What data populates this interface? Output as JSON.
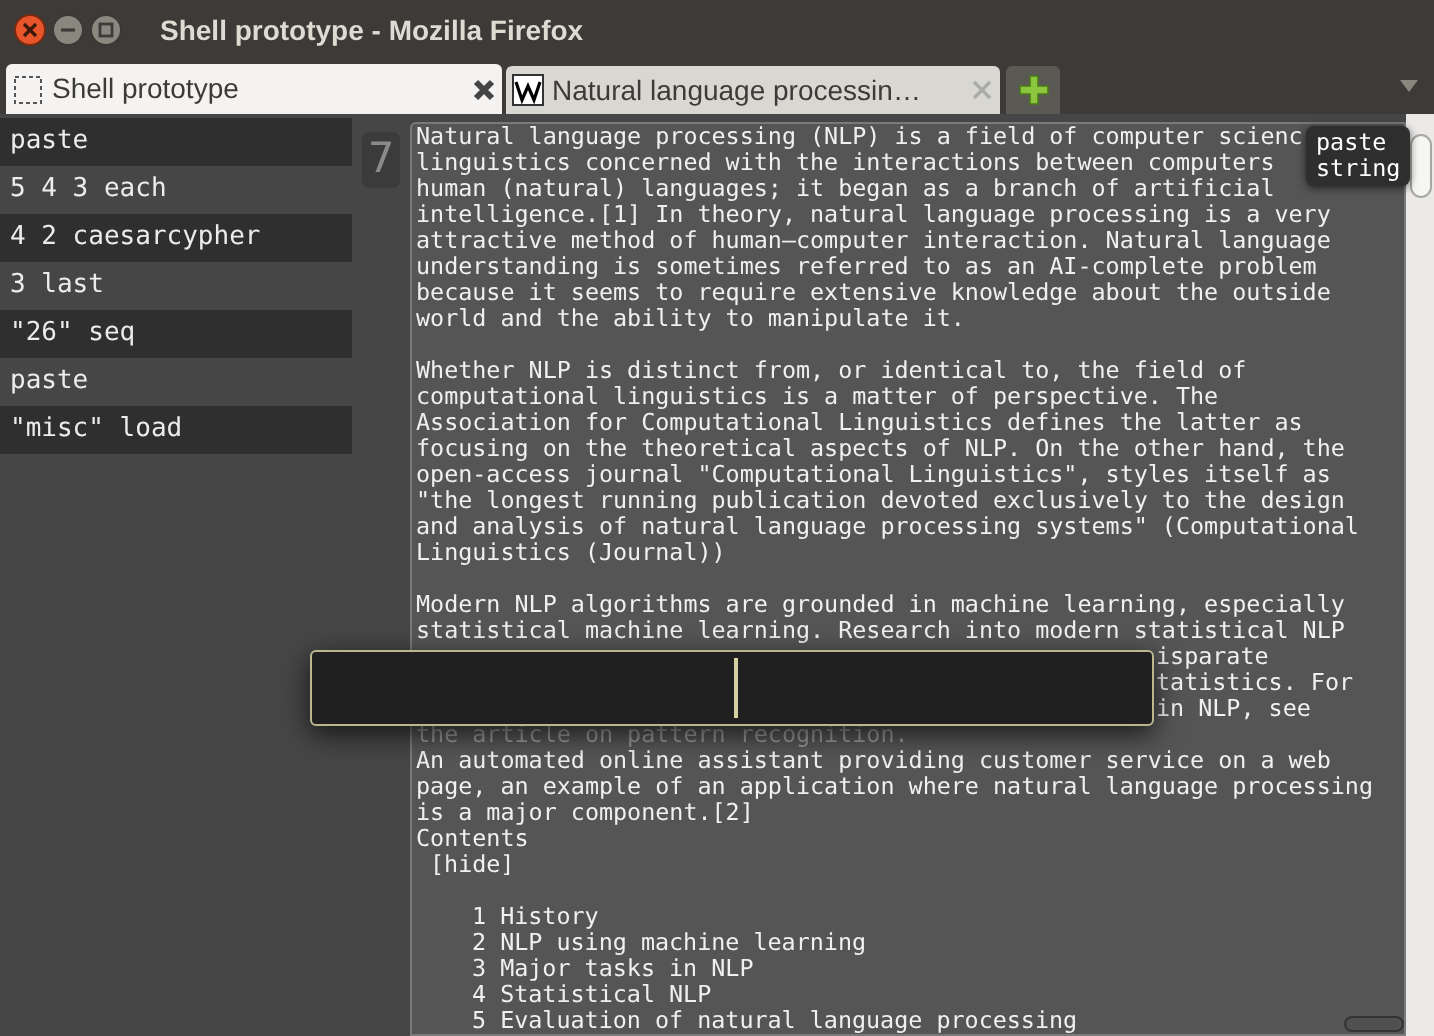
{
  "window": {
    "title": "Shell prototype - Mozilla Firefox"
  },
  "tabs": [
    {
      "label": "Shell prototype",
      "selected": true,
      "kind": "blank"
    },
    {
      "label": "Natural language processin…",
      "selected": false,
      "kind": "wiki"
    }
  ],
  "commands": [
    "paste",
    "5 4 3 each",
    "4 2 caesarcypher",
    "3 last",
    "\"26\" seq",
    "paste",
    "\"misc\" load"
  ],
  "stack_count": "7",
  "editor": {
    "blocks": [
      {
        "kind": "text",
        "dimmed": false,
        "lines": [
          "Natural language processing (NLP) is a field of computer scienc",
          "linguistics concerned with the interactions between computers"
        ]
      },
      {
        "kind": "text",
        "dimmed": false,
        "lines": [
          "human (natural) languages; it began as a branch of artificial",
          "intelligence.[1] In theory, natural language processing is a very",
          "attractive method of human–computer interaction. Natural language",
          "understanding is sometimes referred to as an AI-complete problem",
          "because it seems to require extensive knowledge about the outside",
          "world and the ability to manipulate it."
        ]
      },
      {
        "kind": "blank"
      },
      {
        "kind": "text",
        "dimmed": false,
        "lines": [
          "Whether NLP is distinct from, or identical to, the field of",
          "computational linguistics is a matter of perspective. The",
          "Association for Computational Linguistics defines the latter as",
          "focusing on the theoretical aspects of NLP. On the other hand, the",
          "open-access journal \"Computational Linguistics\", styles itself as",
          "\"the longest running publication devoted exclusively to the design",
          "and analysis of natural language processing systems\" (Computational",
          "Linguistics (Journal))"
        ]
      },
      {
        "kind": "blank"
      },
      {
        "kind": "text",
        "dimmed": false,
        "lines": [
          "Modern NLP algorithms are grounded in machine learning, especially",
          "statistical machine learning. Research into modern statistical NLP"
        ]
      },
      {
        "kind": "partial",
        "dimmed": false,
        "lines": [
          "isparate"
        ]
      },
      {
        "kind": "partial",
        "dimmed": false,
        "lines": [
          "tatistics. For"
        ]
      },
      {
        "kind": "partial",
        "dimmed": false,
        "lines": [
          "in NLP, see"
        ]
      },
      {
        "kind": "text",
        "dimmed": true,
        "lines": [
          "the article on pattern recognition."
        ]
      },
      {
        "kind": "text",
        "dimmed": false,
        "lines": [
          "An automated online assistant providing customer service on a web",
          "page, an example of an application where natural language processing",
          "is a major component.[2]"
        ]
      },
      {
        "kind": "text",
        "dimmed": false,
        "lines": [
          "Contents"
        ]
      },
      {
        "kind": "link",
        "dimmed": false,
        "lines": [
          "[hide]"
        ]
      },
      {
        "kind": "blank"
      },
      {
        "kind": "toc",
        "dimmed": false,
        "lines": [
          "1 History",
          "2 NLP using machine learning",
          "3 Major tasks in NLP",
          "4 Statistical NLP",
          "5 Evaluation of natural language processing"
        ]
      }
    ]
  },
  "tooltip": {
    "lines": [
      "paste",
      "string"
    ]
  },
  "input_popup": {
    "focused": true
  }
}
